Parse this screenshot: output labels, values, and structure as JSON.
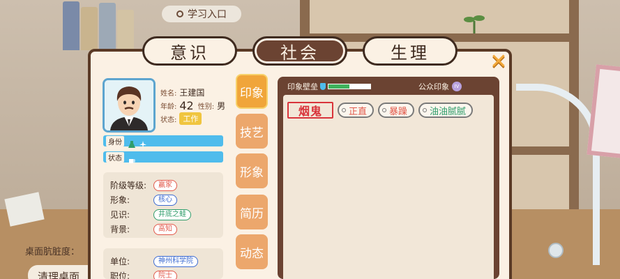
{
  "entry_button": "学习入口",
  "desk_label": "桌面肮脏度：",
  "clean_button": "清理桌面",
  "tabs": [
    {
      "label": "意识",
      "active": false
    },
    {
      "label": "社会",
      "active": true
    },
    {
      "label": "生理",
      "active": false
    }
  ],
  "close_icon": "close-icon",
  "profile": {
    "name_key": "姓名:",
    "name": "王建国",
    "age_key": "年龄:",
    "age": "42",
    "gender_key": "性别:",
    "gender": "男",
    "status_key": "状态:",
    "status": "工作"
  },
  "bars": [
    {
      "label": "身份",
      "icons": [
        "flask-icon",
        "airplane-icon"
      ]
    },
    {
      "label": "状态",
      "icons": [
        "cup-icon"
      ]
    }
  ],
  "attributes": [
    {
      "key": "阶级等级:",
      "value": "赢家",
      "color": "red"
    },
    {
      "key": "形象:",
      "value": "核心",
      "color": "blue"
    },
    {
      "key": "见识:",
      "value": "井底之蛙",
      "color": "green"
    },
    {
      "key": "背景:",
      "value": "高知",
      "color": "red"
    }
  ],
  "work": [
    {
      "key": "单位:",
      "value": "神州科学院",
      "color": "blue"
    },
    {
      "key": "职位:",
      "value": "院士",
      "color": "red"
    }
  ],
  "side_tabs": [
    "印象",
    "技艺",
    "形象",
    "简历",
    "动态"
  ],
  "impression": {
    "wall_label": "印象壁垒",
    "progress": 0.5,
    "public_label": "公众印象",
    "public_level": "IV"
  },
  "tags": {
    "stamp": "烟鬼",
    "pills": [
      {
        "label": "正直",
        "color": "red"
      },
      {
        "label": "暴躁",
        "color": "red"
      },
      {
        "label": "油油腻腻",
        "color": "green"
      }
    ]
  },
  "colors": {
    "panel_bg": "#fbf1e4",
    "panel_border": "#5a3a26",
    "active_tab": "#6b4332",
    "side_tab": "#eca76c",
    "blue_bar": "#4fbcec",
    "progress": "#3fb35d",
    "close": "#f2a93b"
  }
}
